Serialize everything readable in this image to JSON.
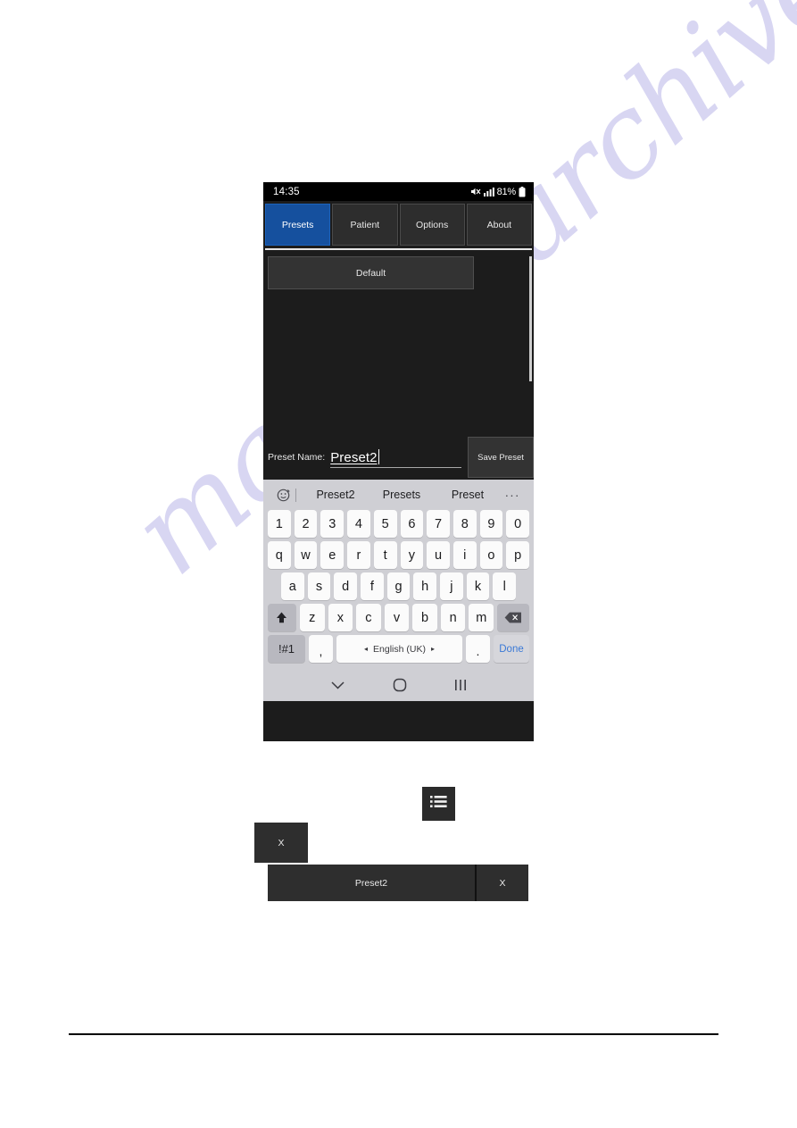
{
  "watermark": {
    "text": "manualsarchive.com"
  },
  "phone": {
    "status_bar": {
      "clock": "14:35",
      "battery_percent": "81%",
      "icons": [
        "mute-icon",
        "signal-bars-icon",
        "battery-icon"
      ]
    },
    "tabs": [
      {
        "label": "Presets",
        "active": true
      },
      {
        "label": "Patient",
        "active": false
      },
      {
        "label": "Options",
        "active": false
      },
      {
        "label": "About",
        "active": false
      }
    ],
    "preset_list": {
      "items": [
        {
          "label": "Default"
        }
      ]
    },
    "preset_name": {
      "label": "Preset Name:",
      "value": "Preset2",
      "save_button": "Save Preset"
    },
    "keyboard": {
      "suggestions": [
        "Preset2",
        "Presets",
        "Preset"
      ],
      "more_label": "···",
      "row_numbers": [
        "1",
        "2",
        "3",
        "4",
        "5",
        "6",
        "7",
        "8",
        "9",
        "0"
      ],
      "row_q": [
        "q",
        "w",
        "e",
        "r",
        "t",
        "y",
        "u",
        "i",
        "o",
        "p"
      ],
      "row_a": [
        "a",
        "s",
        "d",
        "f",
        "g",
        "h",
        "j",
        "k",
        "l"
      ],
      "row_z": [
        "z",
        "x",
        "c",
        "v",
        "b",
        "n",
        "m"
      ],
      "symbols_key": "!#1",
      "comma_key": ",",
      "period_key": ".",
      "space_key": "English (UK)",
      "space_arrow_left": "◂",
      "space_arrow_right": "▸",
      "done_key": "Done"
    },
    "nav_bar": {
      "back_icon": "chevron-down-icon",
      "home_icon": "circle-home-icon",
      "recents_icon": "recents-bars-icon"
    }
  },
  "callouts": {
    "list_icon_name": "list-icon",
    "delete_button_label": "X",
    "preset_row": {
      "name": "Preset2",
      "delete_label": "X"
    }
  },
  "colors": {
    "accent_blue": "#15509E",
    "panel_dark": "#1C1C1C",
    "row_dark": "#333333",
    "keyboard_bg": "#CFCFD4",
    "done_blue": "#3B79D6"
  }
}
